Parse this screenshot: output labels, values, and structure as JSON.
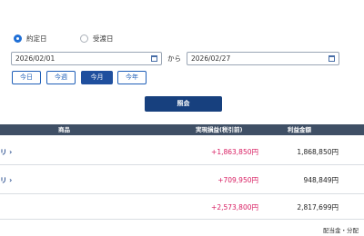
{
  "radios": [
    {
      "label": "約定日",
      "checked": true
    },
    {
      "label": "受渡日",
      "checked": false
    }
  ],
  "date_from": "2026/02/01",
  "range_sep": "から",
  "date_to": "2026/02/27",
  "period_buttons": [
    {
      "label": "今日",
      "active": false
    },
    {
      "label": "今週",
      "active": false
    },
    {
      "label": "今月",
      "active": true
    },
    {
      "label": "今年",
      "active": false
    }
  ],
  "search_label": "照会",
  "table": {
    "headers": {
      "product": "商品",
      "realized": "実現損益(税引前)",
      "profit": "利益金額"
    },
    "rows": [
      {
        "product_suffix": "リ ›",
        "realized": "+1,863,850円",
        "profit": "1,868,850円"
      },
      {
        "product_suffix": "リ ›",
        "realized": "+709,950円",
        "profit": "948,849円"
      }
    ],
    "total": {
      "realized": "+2,573,800円",
      "profit": "2,817,699円"
    }
  },
  "footer_text": "配当金・分配"
}
